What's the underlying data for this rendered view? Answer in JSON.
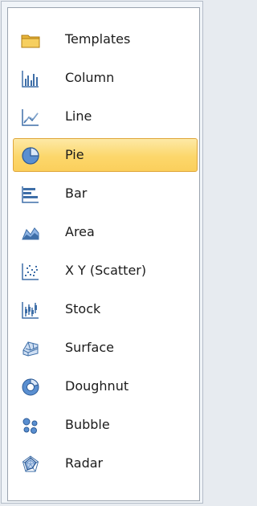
{
  "chart_types": {
    "selected": "Pie",
    "items": [
      {
        "label": "Templates",
        "icon": "folder-icon"
      },
      {
        "label": "Column",
        "icon": "column-chart-icon"
      },
      {
        "label": "Line",
        "icon": "line-chart-icon"
      },
      {
        "label": "Pie",
        "icon": "pie-chart-icon"
      },
      {
        "label": "Bar",
        "icon": "bar-chart-icon"
      },
      {
        "label": "Area",
        "icon": "area-chart-icon"
      },
      {
        "label": "X Y (Scatter)",
        "icon": "scatter-chart-icon"
      },
      {
        "label": "Stock",
        "icon": "stock-chart-icon"
      },
      {
        "label": "Surface",
        "icon": "surface-chart-icon"
      },
      {
        "label": "Doughnut",
        "icon": "doughnut-chart-icon"
      },
      {
        "label": "Bubble",
        "icon": "bubble-chart-icon"
      },
      {
        "label": "Radar",
        "icon": "radar-chart-icon"
      }
    ]
  },
  "colors": {
    "selection_fill": "#fcd76b",
    "selection_border": "#dfa63a",
    "icon_blue": "#3f6fa8",
    "folder_gold": "#e8b53a"
  }
}
